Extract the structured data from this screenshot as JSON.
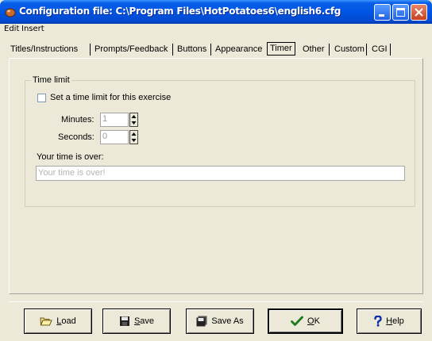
{
  "window": {
    "title": "Configuration file: C:\\Program Files\\HotPotatoes6\\english6.cfg",
    "icons": [
      "app-icon",
      "minimize-icon",
      "maximize-icon",
      "close-icon"
    ],
    "title_color": "#0055E5"
  },
  "menu": {
    "items": [
      {
        "label": "Edit"
      },
      {
        "label": "Insert"
      }
    ]
  },
  "tabs": [
    {
      "label": "Titles/Instructions"
    },
    {
      "label": "Prompts/Feedback"
    },
    {
      "label": "Buttons"
    },
    {
      "label": "Appearance"
    },
    {
      "label": "Timer",
      "active": true
    },
    {
      "label": "Other"
    },
    {
      "label": "Custom"
    },
    {
      "label": "CGI"
    }
  ],
  "timer": {
    "group_title": "Time limit",
    "checkbox_label": "Set a time limit for this exercise",
    "checkbox_checked": false,
    "minutes_label": "Minutes:",
    "minutes_value": "1",
    "seconds_label": "Seconds:",
    "seconds_value": "0",
    "over_label": "Your time is over:",
    "over_value": "Your time is over!"
  },
  "buttons": [
    {
      "label": "Load",
      "icon": "folder-open-icon"
    },
    {
      "label": "Save",
      "icon": "floppy-disk-icon"
    },
    {
      "label": "Save As",
      "icon": "floppy-disk-multi-icon"
    },
    {
      "label": "OK",
      "icon": "checkmark-icon"
    },
    {
      "label": "Help",
      "icon": "question-mark-icon"
    }
  ]
}
